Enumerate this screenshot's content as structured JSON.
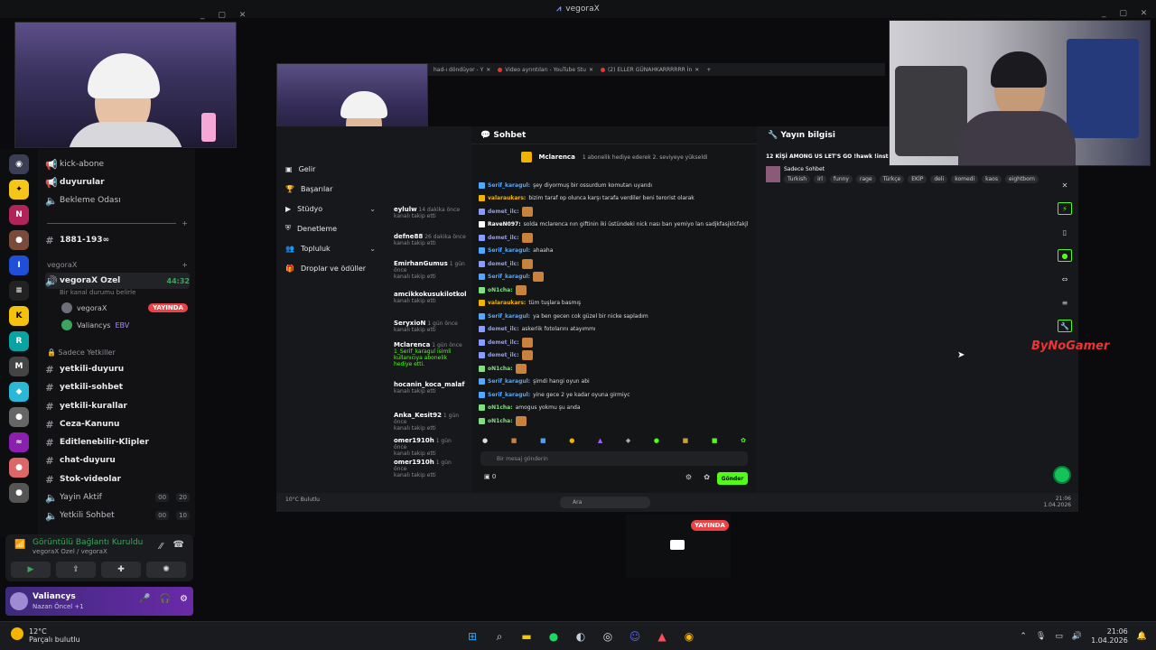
{
  "window_title": "vegoraX",
  "discord": {
    "top_channels": [
      {
        "label": "kick-abone"
      },
      {
        "label": "duyurular"
      },
      {
        "label": "Bekleme Odası"
      },
      {
        "label": "1881-193∞"
      }
    ],
    "category_main": "vegoraX",
    "active_voice": {
      "label": "vegoraX Ozel",
      "time": "44:32",
      "status": "Bir kanal durumu belirle"
    },
    "voice_users": [
      {
        "name": "vegoraX",
        "badge": "YAYINDA"
      },
      {
        "name": "Valiancys",
        "tag": "EBV"
      }
    ],
    "category_staff": "Sadece Yetkiller",
    "staff_channels": [
      {
        "label": "yetkili-duyuru"
      },
      {
        "label": "yetkili-sohbet"
      },
      {
        "label": "yetkili-kurallar"
      },
      {
        "label": "Ceza-Kanunu"
      },
      {
        "label": "Editlenebilir-Klipler"
      },
      {
        "label": "chat-duyuru"
      },
      {
        "label": "Stok-videolar"
      },
      {
        "label": "Yayin Aktif",
        "c1": "00",
        "c2": "20"
      },
      {
        "label": "Yetkili Sohbet",
        "c1": "00",
        "c2": "10"
      }
    ],
    "voice_panel": {
      "status": "Görüntülü Bağlantı Kuruldu",
      "sub": "vegoraX Ozel / vegoraX"
    },
    "user": {
      "name": "Valiancys",
      "sub": "Nazan Öncel +1"
    }
  },
  "studio": {
    "nav": [
      {
        "label": "Gelir"
      },
      {
        "label": "Başarılar"
      },
      {
        "label": "Stüdyo"
      },
      {
        "label": "Denetleme"
      },
      {
        "label": "Topluluk"
      },
      {
        "label": "Droplar ve ödüller"
      }
    ],
    "events": [
      {
        "name": "eylulw",
        "time": "14 dakika önce",
        "desc": "kanalı takip etti"
      },
      {
        "name": "defne88",
        "time": "26 dakika önce",
        "desc": "kanalı takip etti"
      },
      {
        "name": "EmirhanGumus",
        "time": "1 gün önce",
        "desc": "kanalı takip etti"
      },
      {
        "name": "amcikkokusukilotkol",
        "time": "",
        "desc": "kanalı takip etti"
      },
      {
        "name": "SeryxioN",
        "time": "1 gün önce",
        "desc": "kanalı takip etti"
      },
      {
        "name": "Mclarenca",
        "time": "1 gün önce",
        "desc": "1_Serif_karagul isimli kullanıcıya abonelik hediye etti."
      },
      {
        "name": "hocanin_koca_malaf",
        "time": "",
        "desc": "kanalı takip etti"
      },
      {
        "name": "Anka_Kesit92",
        "time": "1 gün önce",
        "desc": "kanalı takip etti"
      },
      {
        "name": "omer1910h",
        "time": "1 gün önce",
        "desc": "kanalı takip etti"
      },
      {
        "name": "omer1910h",
        "time": "1 gün önce",
        "desc": "kanalı takip etti"
      }
    ],
    "chat_title": "Sohbet",
    "pinned_user": "Mclarenca",
    "pinned_text": "1 abonelik hediye ederek 2. seviyeye yükseldi",
    "messages": [
      {
        "user": "Serif_karagul:",
        "text": "şey diyormuş bir ossurdum komutan uyandı",
        "color": "#53a8ff",
        "emote": false
      },
      {
        "user": "valaraukars:",
        "text": "bizim taraf op olunca karşı tarafa verdiler beni terorist olarak",
        "color": "#f0b400",
        "emote": false
      },
      {
        "user": "demet_ilc:",
        "text": "",
        "color": "#8a9cff",
        "emote": true
      },
      {
        "user": "RaveN097:",
        "text": "solda mclarenca nın giftinin iki üstündeki nick nası ban yemiyo lan sadjkfasjklcfakjl",
        "color": "#ffffff",
        "emote": false
      },
      {
        "user": "demet_ilc:",
        "text": "",
        "color": "#8a9cff",
        "emote": true
      },
      {
        "user": "Serif_karagul:",
        "text": "ahaaha",
        "color": "#53a8ff",
        "emote": false
      },
      {
        "user": "demet_ilc:",
        "text": "",
        "color": "#8a9cff",
        "emote": true
      },
      {
        "user": "Serif_karagul:",
        "text": "",
        "color": "#53a8ff",
        "emote": true
      },
      {
        "user": "oN1cha:",
        "text": "",
        "color": "#7fe07f",
        "emote": true
      },
      {
        "user": "valaraukars:",
        "text": "tüm tuşlara basmış",
        "color": "#f0b400",
        "emote": false
      },
      {
        "user": "Serif_karagul:",
        "text": "ya ben gecen cok güzel bir nicke sapladım",
        "color": "#53a8ff",
        "emote": false
      },
      {
        "user": "demet_ilc:",
        "text": "askerlik fotolarını atayımmı",
        "color": "#8a9cff",
        "emote": false
      },
      {
        "user": "demet_ilc:",
        "text": "",
        "color": "#8a9cff",
        "emote": true
      },
      {
        "user": "demet_ilc:",
        "text": "",
        "color": "#8a9cff",
        "emote": true
      },
      {
        "user": "oN1cha:",
        "text": "",
        "color": "#7fe07f",
        "emote": true
      },
      {
        "user": "Serif_karagul:",
        "text": "şimdi hangi oyun abi",
        "color": "#53a8ff",
        "emote": false
      },
      {
        "user": "Serif_karagul:",
        "text": "yine gece 2 ye kadar oyuna girmiyc",
        "color": "#53a8ff",
        "emote": false
      },
      {
        "user": "oN1cha:",
        "text": "amogus yokmu şu anda",
        "color": "#7fe07f",
        "emote": false
      },
      {
        "user": "oN1cha:",
        "text": "",
        "color": "#7fe07f",
        "emote": true
      }
    ],
    "input_placeholder": "Bir mesaj gönderin",
    "send_label": "Gönder",
    "points": "0",
    "info_title": "Yayın bilgisi",
    "stream_title": "12 KİŞİ AMONG US LET'S GO !hawk !insta",
    "category": "Sadece Sohbet",
    "tags": [
      "Turkish",
      "irl",
      "funny",
      "rage",
      "Türkçe",
      "EKİP",
      "deli",
      "komedi",
      "kaos",
      "eightborn"
    ],
    "inner_weather": "10°C Bulutlu",
    "inner_search": "Ara",
    "inner_clock": "21:06",
    "inner_date": "1.04.2026"
  },
  "browser_tabs": [
    "had-ı döndüyor - Y",
    "Video ayrıntıları - YouTube Stu",
    "(2) ELLER GÜNAHKARRRRRR İn"
  ],
  "live_badge": "YAYINDA",
  "watermark": "ByNoGamer",
  "taskbar": {
    "temp": "12°C",
    "weather": "Parçalı bulutlu",
    "time": "21:06",
    "date": "1.04.2026"
  }
}
